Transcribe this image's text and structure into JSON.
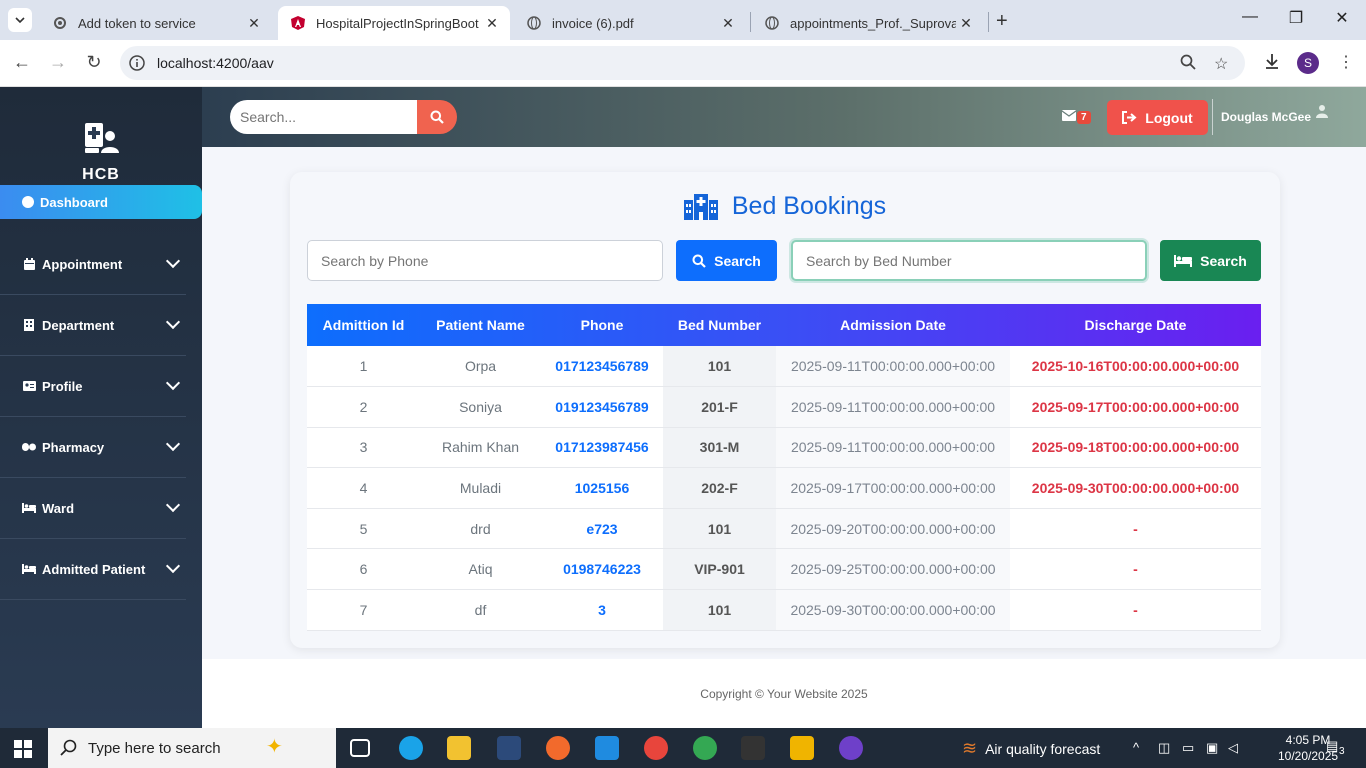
{
  "browser": {
    "tabs": [
      {
        "title": "Add token to service",
        "active": false
      },
      {
        "title": "HospitalProjectInSpringBoot",
        "active": true
      },
      {
        "title": "invoice (6).pdf",
        "active": false
      },
      {
        "title": "appointments_Prof._Suprova_Sl",
        "active": false
      }
    ],
    "url": "localhost:4200/aav",
    "profile_initial": "S"
  },
  "sidebar": {
    "brand": "HCB",
    "dashboard_label": "Dashboard",
    "items": [
      {
        "label": "Appointment",
        "icon": "calendar-icon"
      },
      {
        "label": "Department",
        "icon": "building-icon"
      },
      {
        "label": "Profile",
        "icon": "id-card-icon"
      },
      {
        "label": "Pharmacy",
        "icon": "pills-icon"
      },
      {
        "label": "Ward",
        "icon": "bed-icon"
      },
      {
        "label": "Admitted Patient",
        "icon": "bed-icon"
      }
    ]
  },
  "topbar": {
    "search_placeholder": "Search...",
    "mail_count": "7",
    "logout_label": "Logout",
    "username": "Douglas McGee"
  },
  "main": {
    "title": "Bed Bookings",
    "phone_placeholder": "Search by Phone",
    "search_label": "Search",
    "bed_placeholder": "Search by Bed Number",
    "bed_search_label": "Search",
    "columns": [
      "Admittion Id",
      "Patient Name",
      "Phone",
      "Bed Number",
      "Admission Date",
      "Discharge Date"
    ],
    "rows": [
      [
        "1",
        "Orpa",
        "017123456789",
        "101",
        "2025-09-11T00:00:00.000+00:00",
        "2025-10-16T00:00:00.000+00:00"
      ],
      [
        "2",
        "Soniya",
        "019123456789",
        "201-F",
        "2025-09-11T00:00:00.000+00:00",
        "2025-09-17T00:00:00.000+00:00"
      ],
      [
        "3",
        "Rahim Khan",
        "017123987456",
        "301-M",
        "2025-09-11T00:00:00.000+00:00",
        "2025-09-18T00:00:00.000+00:00"
      ],
      [
        "4",
        "Muladi",
        "1025156",
        "202-F",
        "2025-09-17T00:00:00.000+00:00",
        "2025-09-30T00:00:00.000+00:00"
      ],
      [
        "5",
        "drd",
        "e723",
        "101",
        "2025-09-20T00:00:00.000+00:00",
        "-"
      ],
      [
        "6",
        "Atiq",
        "0198746223",
        "VIP-901",
        "2025-09-25T00:00:00.000+00:00",
        "-"
      ],
      [
        "7",
        "df",
        "3",
        "101",
        "2025-09-30T00:00:00.000+00:00",
        "-"
      ]
    ]
  },
  "footer": {
    "text": "Copyright © Your Website 2025"
  },
  "taskbar": {
    "search_placeholder": "Type here to search",
    "weather": "Air quality forecast",
    "time": "4:05 PM",
    "date": "10/20/2025",
    "notifications": "3"
  }
}
